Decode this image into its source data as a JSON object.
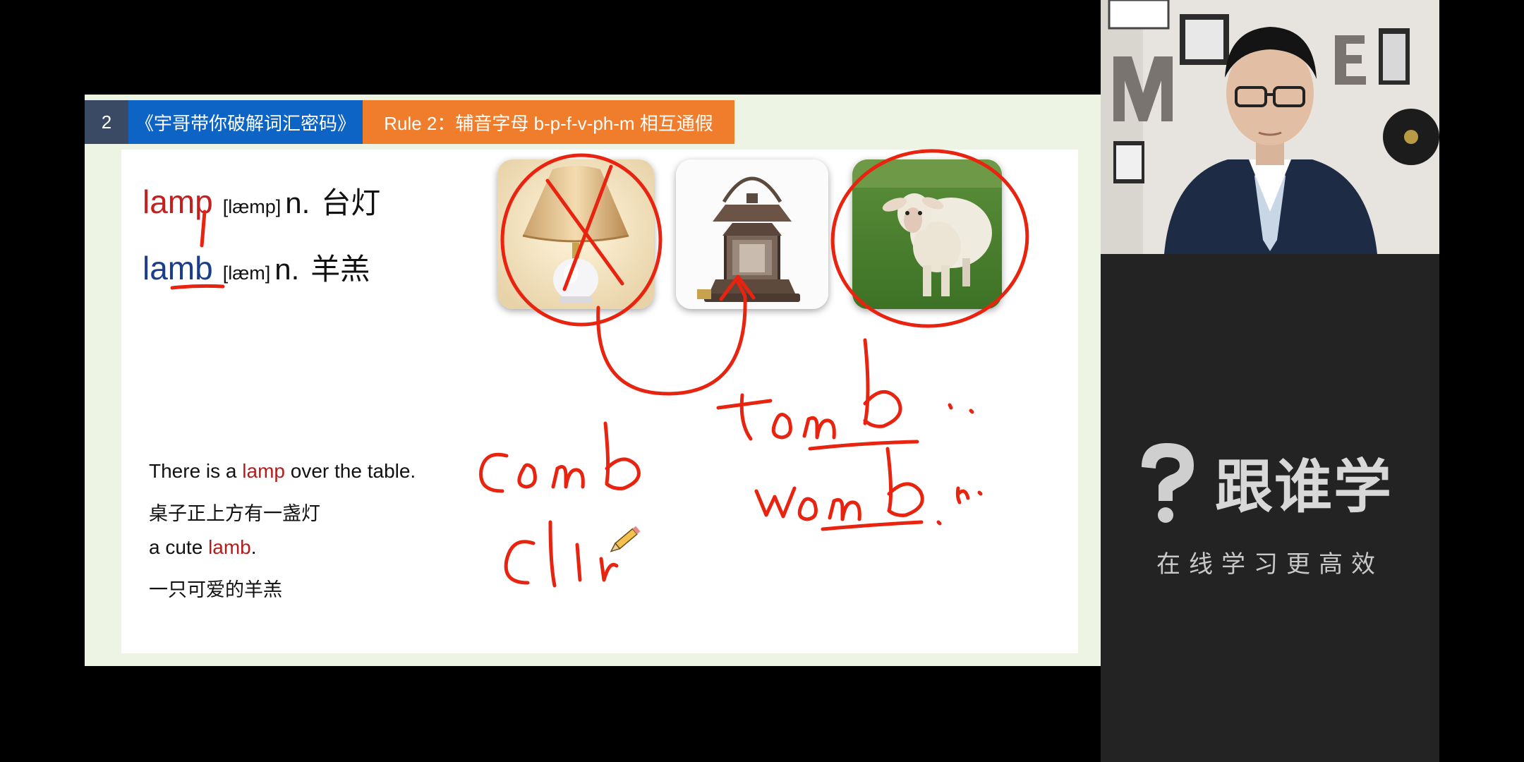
{
  "slide": {
    "header": {
      "number": "2",
      "series": "《宇哥带你破解词汇密码》",
      "rule": "Rule 2：辅音字母  b-p-f-v-ph-m  相互通假"
    },
    "words": [
      {
        "word": "lamp",
        "phonetic": "[læmp]",
        "pos": "n.",
        "meaning": "台灯",
        "color": "#c4201f"
      },
      {
        "word": "lamb",
        "phonetic": "[læm]",
        "pos": "n.",
        "meaning": "羊羔",
        "color": "#1a3e8c"
      }
    ],
    "sentences": {
      "s1_before": "There is a ",
      "s1_key": "lamp",
      "s1_after": " over the table.",
      "s1_cn": "桌子正上方有一盏灯",
      "s2_before": "a cute ",
      "s2_key": "lamb",
      "s2_after": ".",
      "s2_cn": "一只可爱的羊羔"
    },
    "images": [
      "table-lamp",
      "oil-lantern",
      "sheep"
    ],
    "annotations": {
      "handwritten_words": [
        "tomb n.",
        "womb. n.",
        "comb",
        "clim"
      ],
      "ink_color": "#e8230f"
    }
  },
  "brand": {
    "name": "跟谁学",
    "slogan": "在线学习更高效"
  }
}
